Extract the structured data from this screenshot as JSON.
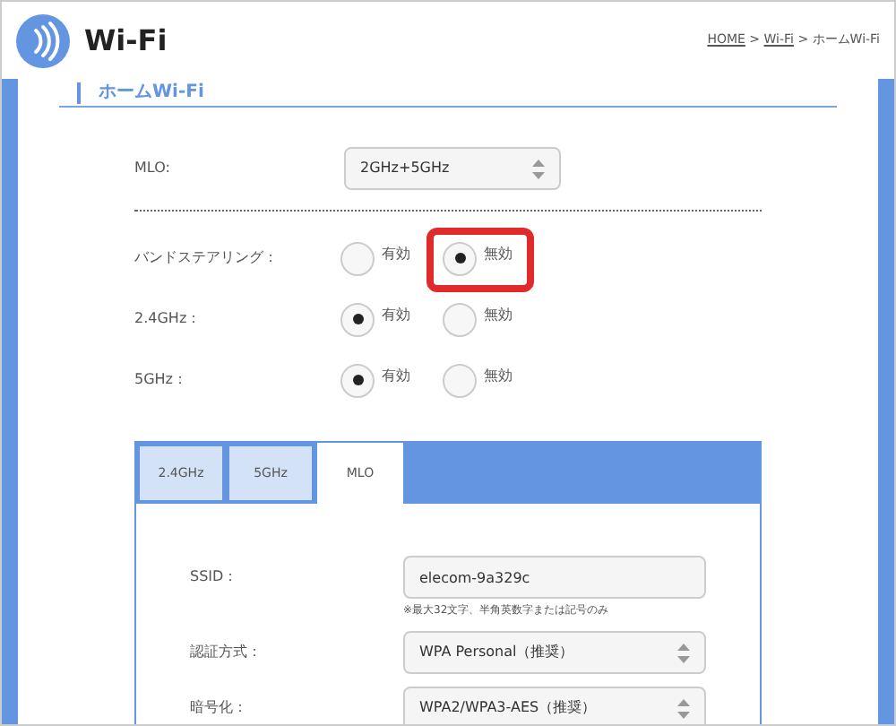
{
  "header": {
    "title": "Wi-Fi",
    "breadcrumb": [
      {
        "label": "HOME",
        "link": true
      },
      {
        "label": " > ",
        "link": false
      },
      {
        "label": "Wi-Fi",
        "link": true
      },
      {
        "label": " > ホームWi-Fi",
        "link": false
      }
    ]
  },
  "section_title": "ホームWi-Fi",
  "mlo": {
    "label": "MLO:",
    "value": "2GHz+5GHz"
  },
  "radio_rows": [
    {
      "label": "バンドステアリング：",
      "options": [
        {
          "label": "有効",
          "selected": false,
          "highlighted": false
        },
        {
          "label": "無効",
          "selected": true,
          "highlighted": true
        }
      ]
    },
    {
      "label": "2.4GHz：",
      "options": [
        {
          "label": "有効",
          "selected": true,
          "highlighted": false
        },
        {
          "label": "無効",
          "selected": false,
          "highlighted": false
        }
      ]
    },
    {
      "label": "5GHz：",
      "options": [
        {
          "label": "有効",
          "selected": true,
          "highlighted": false
        },
        {
          "label": "無効",
          "selected": false,
          "highlighted": false
        }
      ]
    }
  ],
  "tabs": [
    {
      "label": "2.4GHz",
      "selected": false
    },
    {
      "label": "5GHz",
      "selected": false
    },
    {
      "label": "MLO",
      "selected": true
    }
  ],
  "fields": [
    {
      "kind": "input",
      "label": "SSID：",
      "value": "elecom-9a329c",
      "note": "※最大32文字、半角英数字または記号のみ"
    },
    {
      "kind": "select",
      "label": "認証方式：",
      "value": "WPA Personal（推奨）"
    },
    {
      "kind": "select",
      "label": "暗号化：",
      "value": "WPA2/WPA3-AES（推奨）"
    }
  ]
}
